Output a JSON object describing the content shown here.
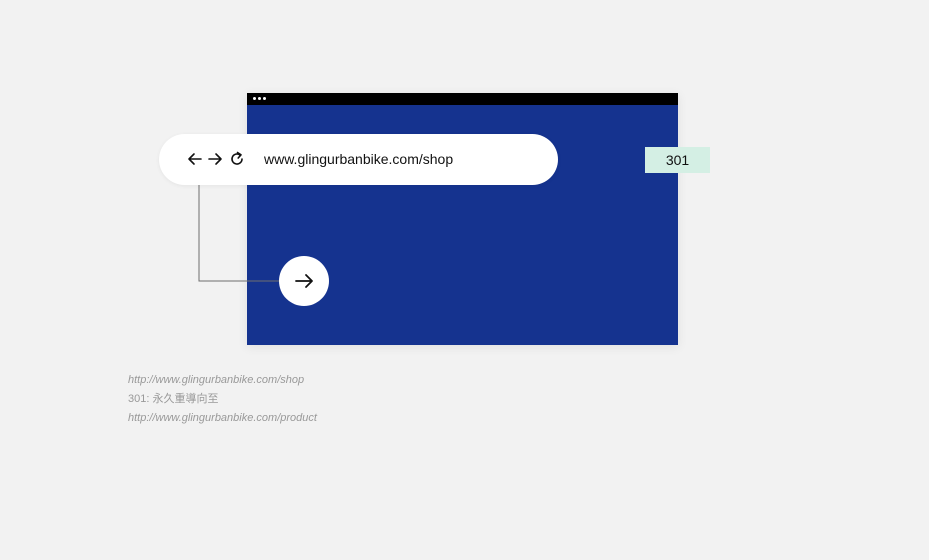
{
  "address_bar": {
    "url": "www.glingurbanbike.com/shop",
    "icons": [
      "back-arrow-icon",
      "forward-arrow-icon",
      "reload-icon"
    ]
  },
  "status_badge": {
    "code": "301"
  },
  "redirect_button": {
    "icon": "arrow-right-icon"
  },
  "captions": {
    "source_url": "http://www.glingurbanbike.com/shop",
    "status_line": "301: 永久重導向至",
    "target_url": "http://www.glingurbanbike.com/product"
  },
  "colors": {
    "window_background": "#15338f",
    "title_bar": "#000000",
    "badge_background": "#d4efe4",
    "page_background": "#f2f2f2"
  }
}
